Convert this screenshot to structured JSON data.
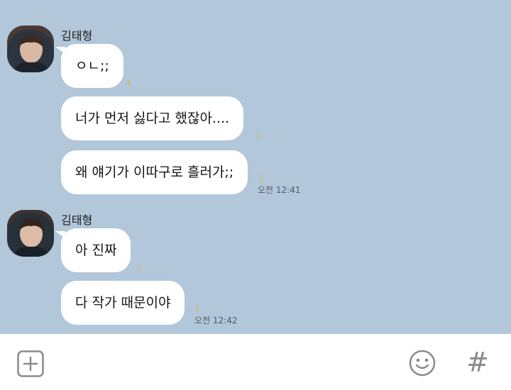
{
  "messages": [
    {
      "sender": "김태형",
      "bubbles": [
        {
          "text": "ㅇㄴ;;",
          "unread": "1"
        },
        {
          "text": "너가 먼저 싫다고 했잖아....",
          "unread": "1"
        },
        {
          "text": "왜 얘기가 이따구로 흘러가;;",
          "unread": "1",
          "time": "오전 12:41"
        }
      ]
    },
    {
      "sender": "김태형",
      "bubbles": [
        {
          "text": "아 진짜",
          "unread": "1"
        },
        {
          "text": "다 작가 때문이야",
          "unread": "1",
          "time": "오전 12:42"
        }
      ]
    }
  ],
  "input_bar": {
    "icons": [
      "plus-icon",
      "emoji-icon",
      "hash-icon"
    ],
    "hash_symbol": "#"
  },
  "colors": {
    "chat_background": "#b2c7da",
    "bubble": "#ffffff",
    "unread": "#d8b84a",
    "icon_gray": "#8a8a8a"
  }
}
